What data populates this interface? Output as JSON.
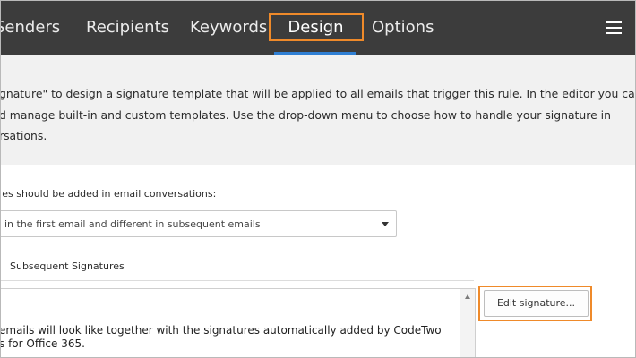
{
  "nav": {
    "tabs": [
      {
        "label": "Senders"
      },
      {
        "label": "Recipients"
      },
      {
        "label": "Keywords"
      },
      {
        "label": "Design",
        "active": true
      },
      {
        "label": "Options"
      }
    ],
    "menu_icon": "hamburger-menu-icon",
    "accent": "#2f7fd3",
    "highlight": "#ef8a2a"
  },
  "info": {
    "lines": [
      "gnature\" to design a signature template that will be applied to all emails that trigger this rule. In the editor you can",
      "d manage built-in and custom templates. Use the drop-down menu to choose how to handle your signature in",
      "rsations."
    ]
  },
  "form": {
    "conversation_label": "res should be added in email conversations:",
    "dropdown_value": " in the first email and different in subsequent emails",
    "sub_tab": "Subsequent Signatures"
  },
  "preview": {
    "lines": [
      "emails will look like together with the signatures automatically added by CodeTwo",
      "s for Office 365."
    ]
  },
  "actions": {
    "edit_signature": "Edit signature..."
  }
}
